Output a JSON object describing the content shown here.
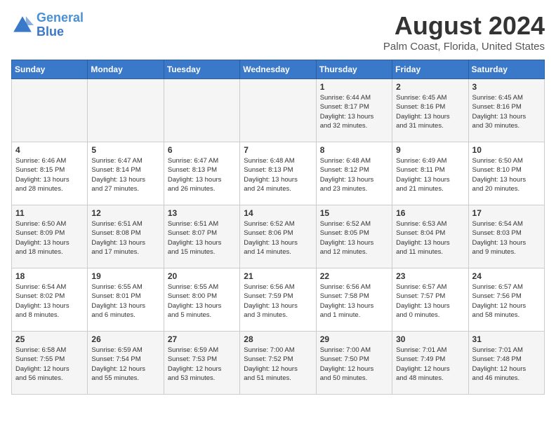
{
  "header": {
    "logo_line1": "General",
    "logo_line2": "Blue",
    "title": "August 2024",
    "subtitle": "Palm Coast, Florida, United States"
  },
  "weekdays": [
    "Sunday",
    "Monday",
    "Tuesday",
    "Wednesday",
    "Thursday",
    "Friday",
    "Saturday"
  ],
  "weeks": [
    [
      {
        "day": "",
        "info": ""
      },
      {
        "day": "",
        "info": ""
      },
      {
        "day": "",
        "info": ""
      },
      {
        "day": "",
        "info": ""
      },
      {
        "day": "1",
        "info": "Sunrise: 6:44 AM\nSunset: 8:17 PM\nDaylight: 13 hours\nand 32 minutes."
      },
      {
        "day": "2",
        "info": "Sunrise: 6:45 AM\nSunset: 8:16 PM\nDaylight: 13 hours\nand 31 minutes."
      },
      {
        "day": "3",
        "info": "Sunrise: 6:45 AM\nSunset: 8:16 PM\nDaylight: 13 hours\nand 30 minutes."
      }
    ],
    [
      {
        "day": "4",
        "info": "Sunrise: 6:46 AM\nSunset: 8:15 PM\nDaylight: 13 hours\nand 28 minutes."
      },
      {
        "day": "5",
        "info": "Sunrise: 6:47 AM\nSunset: 8:14 PM\nDaylight: 13 hours\nand 27 minutes."
      },
      {
        "day": "6",
        "info": "Sunrise: 6:47 AM\nSunset: 8:13 PM\nDaylight: 13 hours\nand 26 minutes."
      },
      {
        "day": "7",
        "info": "Sunrise: 6:48 AM\nSunset: 8:13 PM\nDaylight: 13 hours\nand 24 minutes."
      },
      {
        "day": "8",
        "info": "Sunrise: 6:48 AM\nSunset: 8:12 PM\nDaylight: 13 hours\nand 23 minutes."
      },
      {
        "day": "9",
        "info": "Sunrise: 6:49 AM\nSunset: 8:11 PM\nDaylight: 13 hours\nand 21 minutes."
      },
      {
        "day": "10",
        "info": "Sunrise: 6:50 AM\nSunset: 8:10 PM\nDaylight: 13 hours\nand 20 minutes."
      }
    ],
    [
      {
        "day": "11",
        "info": "Sunrise: 6:50 AM\nSunset: 8:09 PM\nDaylight: 13 hours\nand 18 minutes."
      },
      {
        "day": "12",
        "info": "Sunrise: 6:51 AM\nSunset: 8:08 PM\nDaylight: 13 hours\nand 17 minutes."
      },
      {
        "day": "13",
        "info": "Sunrise: 6:51 AM\nSunset: 8:07 PM\nDaylight: 13 hours\nand 15 minutes."
      },
      {
        "day": "14",
        "info": "Sunrise: 6:52 AM\nSunset: 8:06 PM\nDaylight: 13 hours\nand 14 minutes."
      },
      {
        "day": "15",
        "info": "Sunrise: 6:52 AM\nSunset: 8:05 PM\nDaylight: 13 hours\nand 12 minutes."
      },
      {
        "day": "16",
        "info": "Sunrise: 6:53 AM\nSunset: 8:04 PM\nDaylight: 13 hours\nand 11 minutes."
      },
      {
        "day": "17",
        "info": "Sunrise: 6:54 AM\nSunset: 8:03 PM\nDaylight: 13 hours\nand 9 minutes."
      }
    ],
    [
      {
        "day": "18",
        "info": "Sunrise: 6:54 AM\nSunset: 8:02 PM\nDaylight: 13 hours\nand 8 minutes."
      },
      {
        "day": "19",
        "info": "Sunrise: 6:55 AM\nSunset: 8:01 PM\nDaylight: 13 hours\nand 6 minutes."
      },
      {
        "day": "20",
        "info": "Sunrise: 6:55 AM\nSunset: 8:00 PM\nDaylight: 13 hours\nand 5 minutes."
      },
      {
        "day": "21",
        "info": "Sunrise: 6:56 AM\nSunset: 7:59 PM\nDaylight: 13 hours\nand 3 minutes."
      },
      {
        "day": "22",
        "info": "Sunrise: 6:56 AM\nSunset: 7:58 PM\nDaylight: 13 hours\nand 1 minute."
      },
      {
        "day": "23",
        "info": "Sunrise: 6:57 AM\nSunset: 7:57 PM\nDaylight: 13 hours\nand 0 minutes."
      },
      {
        "day": "24",
        "info": "Sunrise: 6:57 AM\nSunset: 7:56 PM\nDaylight: 12 hours\nand 58 minutes."
      }
    ],
    [
      {
        "day": "25",
        "info": "Sunrise: 6:58 AM\nSunset: 7:55 PM\nDaylight: 12 hours\nand 56 minutes."
      },
      {
        "day": "26",
        "info": "Sunrise: 6:59 AM\nSunset: 7:54 PM\nDaylight: 12 hours\nand 55 minutes."
      },
      {
        "day": "27",
        "info": "Sunrise: 6:59 AM\nSunset: 7:53 PM\nDaylight: 12 hours\nand 53 minutes."
      },
      {
        "day": "28",
        "info": "Sunrise: 7:00 AM\nSunset: 7:52 PM\nDaylight: 12 hours\nand 51 minutes."
      },
      {
        "day": "29",
        "info": "Sunrise: 7:00 AM\nSunset: 7:50 PM\nDaylight: 12 hours\nand 50 minutes."
      },
      {
        "day": "30",
        "info": "Sunrise: 7:01 AM\nSunset: 7:49 PM\nDaylight: 12 hours\nand 48 minutes."
      },
      {
        "day": "31",
        "info": "Sunrise: 7:01 AM\nSunset: 7:48 PM\nDaylight: 12 hours\nand 46 minutes."
      }
    ]
  ]
}
